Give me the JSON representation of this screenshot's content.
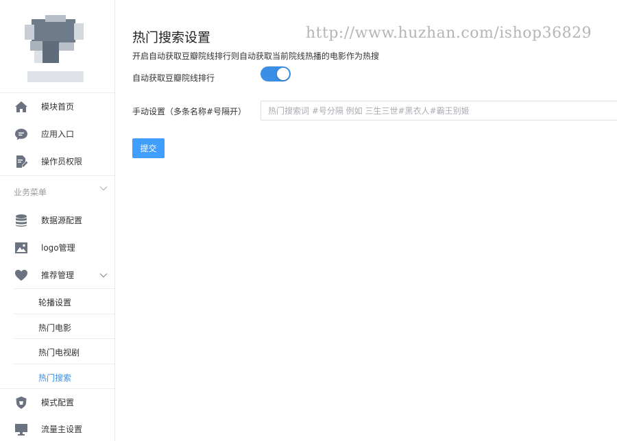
{
  "sidebar": {
    "menu": [
      {
        "label": "模块首页",
        "icon": "home-icon"
      },
      {
        "label": "应用入口",
        "icon": "chat-bubble-icon"
      },
      {
        "label": "操作员权限",
        "icon": "edit-document-icon"
      }
    ],
    "section_title": "业务菜单",
    "business": [
      {
        "label": "数据源配置",
        "icon": "database-icon"
      },
      {
        "label": "logo管理",
        "icon": "image-icon"
      },
      {
        "label": "推荐管理",
        "icon": "heart-icon"
      }
    ],
    "recommend_sub": [
      {
        "label": "轮播设置"
      },
      {
        "label": "热门电影"
      },
      {
        "label": "热门电视剧"
      },
      {
        "label": "热门搜索"
      }
    ],
    "bottom": [
      {
        "label": "模式配置",
        "icon": "shield-icon"
      },
      {
        "label": "流量主设置",
        "icon": "monitor-icon"
      }
    ]
  },
  "main": {
    "title": "热门搜索设置",
    "description": "开启自动获取豆瓣院线排行则自动获取当前院线热播的电影作为热搜",
    "toggle_label": "自动获取豆瓣院线排行",
    "toggle_on": true,
    "manual_label": "手动设置（多条名称#号隔开）",
    "manual_placeholder": "热门搜索词 #号分隔 例如 三生三世#黑衣人#霸王别姬",
    "manual_value": "",
    "submit_label": "提交"
  },
  "watermark": "http://www.huzhan.com/ishop36829",
  "colors": {
    "accent": "#409eff",
    "toggle": "#3a8ee6",
    "icon": "#6b7280",
    "active_text": "#3a8ee6"
  }
}
